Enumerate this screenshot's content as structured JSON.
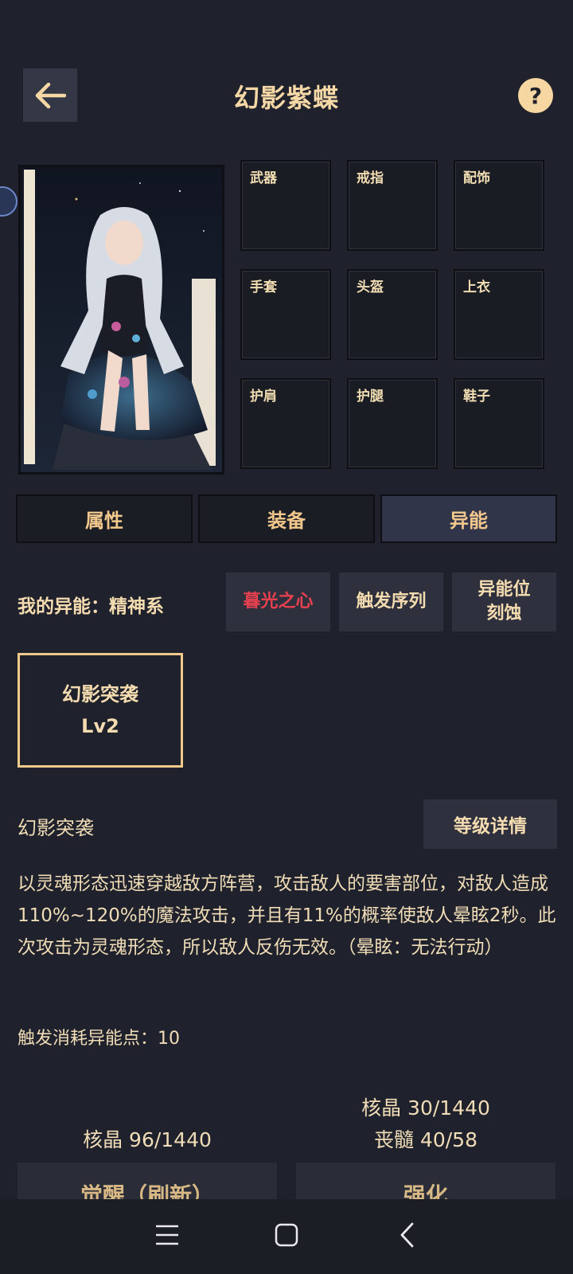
{
  "header": {
    "title": "幻影紫蝶",
    "help_label": "?"
  },
  "equipment_slots": [
    "武器",
    "戒指",
    "配饰",
    "手套",
    "头盔",
    "上衣",
    "护肩",
    "护腿",
    "鞋子"
  ],
  "tabs": [
    {
      "label": "属性",
      "active": false
    },
    {
      "label": "装备",
      "active": false
    },
    {
      "label": "异能",
      "active": true
    }
  ],
  "ability": {
    "my_ability_label": "我的异能：精神系",
    "chips": [
      {
        "label": "暮光之心",
        "color": "#e8404f"
      },
      {
        "label": "触发序列",
        "color": "#f5dcb0"
      },
      {
        "label": "异能位\n刻蚀",
        "color": "#f5dcb0"
      }
    ],
    "chip3_line1": "异能位",
    "chip3_line2": "刻蚀"
  },
  "skill": {
    "card_name": "幻影突袭",
    "card_level": "Lv2",
    "name": "幻影突袭",
    "detail_button": "等级详情",
    "description": "以灵魂形态迅速穿越敌方阵营，攻击敌人的要害部位，对敌人造成110%~120%的魔法攻击，并且有11%的概率使敌人晕眩2秒。此次攻击为灵魂形态，所以敌人反伤无效。（晕眩：无法行动）",
    "cost": "触发消耗异能点：10"
  },
  "costs": {
    "awaken_cost": "核晶 96/1440",
    "enhance_cost_1": "核晶 30/1440",
    "enhance_cost_2": "丧髓 40/58"
  },
  "actions": {
    "awaken_label": "觉醒（刷新）",
    "enhance_label": "强化"
  },
  "colors": {
    "background": "#1f222c",
    "accent_gold": "#f0c98b",
    "accent_red": "#e8404f",
    "active_tab": "#31354a"
  }
}
